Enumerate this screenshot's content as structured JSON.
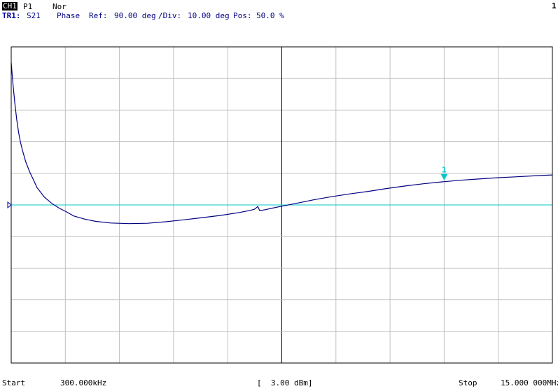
{
  "header": {
    "channel_badge": "CH1",
    "port": "P1",
    "mode": "Nor",
    "window_number": "1",
    "trace_label": "TR1:",
    "parameter": "S21",
    "format": "Phase",
    "ref_label": "Ref:",
    "ref_value": "90.00 deg",
    "div_label": "/Div:",
    "div_value": "10.00 deg",
    "pos_label": "Pos:",
    "pos_value": "50.0 %"
  },
  "footer": {
    "start_label": "Start",
    "start_value": "300.000kHz",
    "power": "[  3.00 dBm]",
    "stop_label": "Stop",
    "stop_value": "15.000 000MHz"
  },
  "colors": {
    "trace": "#000080",
    "reference": "#00c8c8",
    "grid": "#c0c0c0",
    "marker": "#00c8c8"
  },
  "chart_data": {
    "type": "line",
    "x_unit": "MHz",
    "y_unit": "deg",
    "xlim": [
      0.3,
      15.0
    ],
    "ylim": [
      40,
      140
    ],
    "reference_value": 90,
    "grid": true,
    "marker": {
      "label": "1",
      "x": 12.06
    },
    "series": [
      {
        "x": [
          0.3,
          0.35,
          0.4,
          0.45,
          0.5,
          0.55,
          0.6,
          0.7,
          0.8,
          0.9,
          1.0,
          1.2,
          1.4,
          1.6,
          1.8,
          2.0,
          2.3,
          2.6,
          3.0,
          3.5,
          4.0,
          4.5,
          5.0,
          5.5,
          6.0,
          6.5,
          6.8,
          6.9,
          7.0,
          7.05,
          7.2,
          7.4,
          7.6,
          8.0,
          8.5,
          9.0,
          9.5,
          10.0,
          10.5,
          11.0,
          11.5,
          12.0,
          12.5,
          13.0,
          13.5,
          14.0,
          14.5,
          15.0
        ],
        "y": [
          135,
          128,
          122,
          117,
          113,
          110,
          107.5,
          103.5,
          100.5,
          98,
          95.5,
          92.5,
          90.5,
          89,
          87.8,
          86.5,
          85.5,
          84.8,
          84.3,
          84.1,
          84.2,
          84.7,
          85.3,
          86,
          86.7,
          87.6,
          88.3,
          88.6,
          89.5,
          88.2,
          88.5,
          89,
          89.5,
          90.4,
          91.6,
          92.6,
          93.5,
          94.3,
          95.2,
          96,
          96.7,
          97.3,
          97.8,
          98.2,
          98.6,
          98.9,
          99.2,
          99.5
        ]
      }
    ]
  }
}
